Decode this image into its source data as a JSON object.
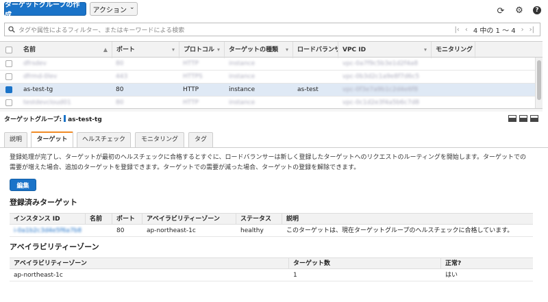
{
  "toolbar": {
    "create_label": "ターゲットグループの作成",
    "actions_label": "アクション",
    "chevron": "⌄",
    "refresh_glyph": "⟳",
    "settings_glyph": "⚙",
    "help_glyph": "?"
  },
  "search": {
    "placeholder": "タグや属性によるフィルター、またはキーワードによる検索",
    "pager_first": "|‹",
    "pager_prev": "‹",
    "pager_count": "4 中の 1 ～ 4",
    "pager_next": "›",
    "pager_last": "›|"
  },
  "grid": {
    "headers": [
      "名前",
      "ポート",
      "プロトコル",
      "ターゲットの種類",
      "ロードバランサー",
      "VPC ID",
      "モニタリング"
    ],
    "sort_glyph": "▲",
    "dropdown_glyph": "▾",
    "rows": [
      {
        "name": "dfrsdev",
        "port": "80",
        "protocol": "HTTP",
        "type": "instance",
        "lb": "",
        "vpc": "vpc-0a7f9c5b3e1d2f4a8",
        "selected": false,
        "blurred": true
      },
      {
        "name": "dfrmd-0lev",
        "port": "443",
        "protocol": "HTTPS",
        "type": "instance",
        "lb": "",
        "vpc": "vpc-0b3d2c1a9e8f7d6c5",
        "selected": false,
        "blurred": true
      },
      {
        "name": "as-test-tg",
        "port": "80",
        "protocol": "HTTP",
        "type": "instance",
        "lb": "as-test",
        "vpc": "vpc-0f3e7a9b1c2d4e6f8",
        "selected": true,
        "blurred": false
      },
      {
        "name": "testdevcloud01",
        "port": "80",
        "protocol": "HTTP",
        "type": "instance",
        "lb": "",
        "vpc": "vpc-0c1d2e3f4a5b6c7d8",
        "selected": false,
        "blurred": true
      }
    ]
  },
  "detail": {
    "label": "ターゲットグループ:",
    "name": "as-test-tg",
    "tabs": [
      "説明",
      "ターゲット",
      "ヘルスチェック",
      "モニタリング",
      "タグ"
    ],
    "active_tab": 1,
    "description": "登録処理が完了し、ターゲットが最初のヘルスチェックに合格するとすぐに、ロードバランサーは新しく登録したターゲットへのリクエストのルーティングを開始します。ターゲットでの需要が増えた場合、追加のターゲットを登録できます。ターゲットでの需要が減った場合、ターゲットの登録を解除できます。",
    "edit_label": "編集",
    "registered_title": "登録済みターゲット",
    "registered_headers": [
      "インスタンス ID",
      "名前",
      "ポート",
      "アベイラビリティーゾーン",
      "ステータス",
      "説明"
    ],
    "registered_rows": [
      {
        "instance_id": "i-0a1b2c3d4e5f6a7b8",
        "name": "",
        "port": "80",
        "az": "ap-northeast-1c",
        "status": "healthy",
        "desc": "このターゲットは、現在ターゲットグループのヘルスチェックに合格しています。"
      }
    ],
    "az_title": "アベイラビリティーゾーン",
    "az_headers": [
      "アベイラビリティーゾーン",
      "ターゲット数",
      "正常?"
    ],
    "az_rows": [
      {
        "az": "ap-northeast-1c",
        "count": "1",
        "healthy": "はい"
      }
    ]
  },
  "colors": {
    "primary": "#1a73c8",
    "tab_accent": "#f08a24",
    "selected_row": "#dfe9f5",
    "link": "#1a6ec6"
  }
}
